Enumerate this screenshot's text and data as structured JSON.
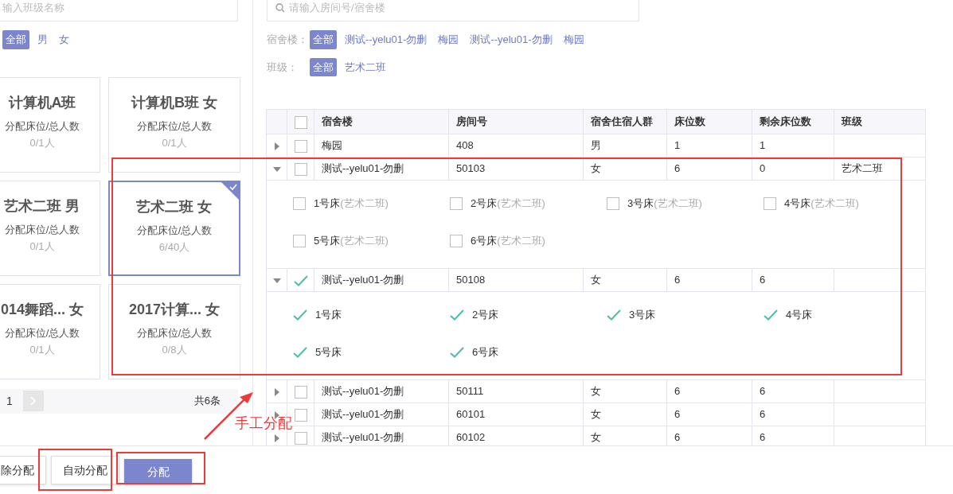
{
  "left_panel": {
    "search": {
      "placeholder": "输入班级名称"
    },
    "gender_filters": [
      {
        "label": "全部",
        "selected": true
      },
      {
        "label": "男",
        "selected": false
      },
      {
        "label": "女",
        "selected": false
      }
    ],
    "class_cards": [
      {
        "title": "计算机A班",
        "subtitle": "分配床位/总人数",
        "count": "0/1人",
        "selected": false
      },
      {
        "title": "计算机B班 女",
        "subtitle": "分配床位/总人数",
        "count": "0/1人",
        "selected": false
      },
      {
        "title": "艺术二班 男",
        "subtitle": "分配床位/总人数",
        "count": "0/1人",
        "selected": false
      },
      {
        "title": "艺术二班 女",
        "subtitle": "分配床位/总人数",
        "count": "6/40人",
        "selected": true
      },
      {
        "title": "014舞蹈... 女",
        "subtitle": "分配床位/总人数",
        "count": "0/1人",
        "selected": false
      },
      {
        "title": "2017计算... 女",
        "subtitle": "分配床位/总人数",
        "count": "0/8人",
        "selected": false
      }
    ],
    "pagination": {
      "page": "1",
      "total": "共6条"
    }
  },
  "right_panel": {
    "search": {
      "placeholder": "请输入房间号/宿舍楼"
    },
    "building_filter": {
      "label": "宿舍楼：",
      "options": [
        {
          "label": "全部",
          "selected": true
        },
        {
          "label": "测试--yelu01-勿删",
          "selected": false
        },
        {
          "label": "梅园",
          "selected": false
        },
        {
          "label": "测试--yelu01-勿删",
          "selected": false
        },
        {
          "label": "梅园",
          "selected": false
        }
      ]
    },
    "class_filter": {
      "label": "班级：",
      "options": [
        {
          "label": "全部",
          "selected": true
        },
        {
          "label": "艺术二班",
          "selected": false
        }
      ]
    },
    "table": {
      "header_checked": false,
      "columns": [
        "宿舍楼",
        "房间号",
        "宿舍住宿人群",
        "床位数",
        "剩余床位数",
        "班级"
      ],
      "rows": [
        {
          "expanded": false,
          "checked": false,
          "cells": [
            "梅园",
            "408",
            "男",
            "1",
            "1",
            ""
          ]
        },
        {
          "expanded": true,
          "checked": false,
          "cells": [
            "测试--yelu01-勿删",
            "50103",
            "女",
            "6",
            "0",
            "艺术二班"
          ],
          "beds": [
            {
              "label": "1号床",
              "note": "(艺术二班)",
              "checked": false
            },
            {
              "label": "2号床",
              "note": "(艺术二班)",
              "checked": false
            },
            {
              "label": "3号床",
              "note": "(艺术二班)",
              "checked": false
            },
            {
              "label": "4号床",
              "note": "(艺术二班)",
              "checked": false
            },
            {
              "label": "5号床",
              "note": "(艺术二班)",
              "checked": false
            },
            {
              "label": "6号床",
              "note": "(艺术二班)",
              "checked": false
            }
          ]
        },
        {
          "expanded": true,
          "checked": true,
          "cells": [
            "测试--yelu01-勿删",
            "50108",
            "女",
            "6",
            "6",
            ""
          ],
          "beds": [
            {
              "label": "1号床",
              "checked": true
            },
            {
              "label": "2号床",
              "checked": true
            },
            {
              "label": "3号床",
              "checked": true
            },
            {
              "label": "4号床",
              "checked": true
            },
            {
              "label": "5号床",
              "checked": true
            },
            {
              "label": "6号床",
              "checked": true
            }
          ]
        },
        {
          "expanded": false,
          "checked": false,
          "cells": [
            "测试--yelu01-勿删",
            "50111",
            "女",
            "6",
            "6",
            ""
          ]
        },
        {
          "expanded": false,
          "checked": false,
          "cells": [
            "测试--yelu01-勿删",
            "60101",
            "女",
            "6",
            "6",
            ""
          ]
        },
        {
          "expanded": false,
          "checked": false,
          "cells": [
            "测试--yelu01-勿删",
            "60102",
            "女",
            "6",
            "6",
            ""
          ]
        }
      ]
    }
  },
  "footer_buttons": [
    {
      "label": "除分配",
      "kind": "default"
    },
    {
      "label": "自动分配",
      "kind": "default"
    },
    {
      "label": "分配",
      "kind": "primary"
    }
  ],
  "annotation": {
    "label": "手工分配"
  }
}
